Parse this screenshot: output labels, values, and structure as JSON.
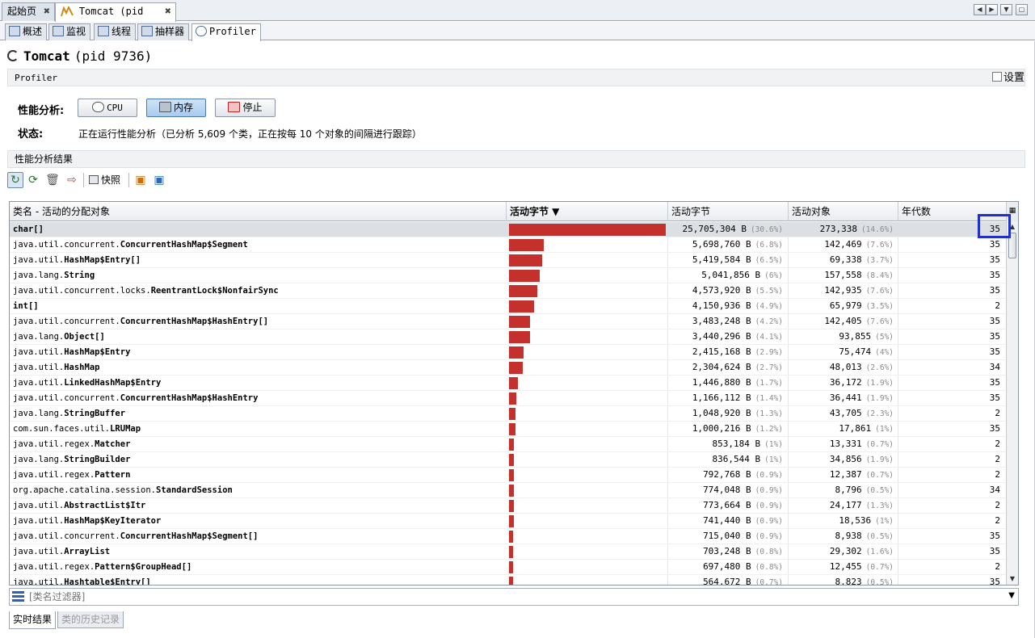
{
  "doc_tabs": [
    {
      "label": "起始页"
    },
    {
      "label": "Tomcat (pid 9736)"
    }
  ],
  "sub_tabs": [
    {
      "label": "概述"
    },
    {
      "label": "监视"
    },
    {
      "label": "线程"
    },
    {
      "label": "抽样器"
    },
    {
      "label": "Profiler"
    }
  ],
  "header": {
    "app_name": "Tomcat",
    "pid": "(pid 9736)"
  },
  "profiler_section": {
    "title": "Profiler",
    "settings_label": "设置"
  },
  "controls": {
    "analysis_label": "性能分析:",
    "cpu_label": "CPU",
    "memory_label": "内存",
    "stop_label": "停止",
    "status_label": "状态:",
    "status_text": "正在运行性能分析（已分析 5,609 个类，正在按每 10 个对象的间隔进行跟踪）"
  },
  "results_section": {
    "title": "性能分析结果",
    "snapshot_label": "快照"
  },
  "table": {
    "columns": [
      "类名 - 活动的分配对象",
      "活动字节 ▼",
      "活动字节",
      "活动对象",
      "年代数"
    ],
    "rows": [
      {
        "pkg": "",
        "cls": "char[]",
        "bytes": "25,705,304 B",
        "bytes_pct": "(30.6%)",
        "objs": "273,338",
        "objs_pct": "(14.6%)",
        "gen": "35",
        "bar": 1.0
      },
      {
        "pkg": "java.util.concurrent.",
        "cls": "ConcurrentHashMap$Segment",
        "bytes": "5,698,760 B",
        "bytes_pct": "(6.8%)",
        "objs": "142,469",
        "objs_pct": "(7.6%)",
        "gen": "35",
        "bar": 0.222
      },
      {
        "pkg": "java.util.",
        "cls": "HashMap$Entry[]",
        "bytes": "5,419,584 B",
        "bytes_pct": "(6.5%)",
        "objs": "69,338",
        "objs_pct": "(3.7%)",
        "gen": "35",
        "bar": 0.211
      },
      {
        "pkg": "java.lang.",
        "cls": "String",
        "bytes": "5,041,856 B",
        "bytes_pct": "(6%)",
        "objs": "157,558",
        "objs_pct": "(8.4%)",
        "gen": "35",
        "bar": 0.196
      },
      {
        "pkg": "java.util.concurrent.locks.",
        "cls": "ReentrantLock$NonfairSync",
        "bytes": "4,573,920 B",
        "bytes_pct": "(5.5%)",
        "objs": "142,935",
        "objs_pct": "(7.6%)",
        "gen": "35",
        "bar": 0.178
      },
      {
        "pkg": "",
        "cls": "int[]",
        "bytes": "4,150,936 B",
        "bytes_pct": "(4.9%)",
        "objs": "65,979",
        "objs_pct": "(3.5%)",
        "gen": "2",
        "bar": 0.161
      },
      {
        "pkg": "java.util.concurrent.",
        "cls": "ConcurrentHashMap$HashEntry[]",
        "bytes": "3,483,248 B",
        "bytes_pct": "(4.2%)",
        "objs": "142,405",
        "objs_pct": "(7.6%)",
        "gen": "35",
        "bar": 0.135
      },
      {
        "pkg": "java.lang.",
        "cls": "Object[]",
        "bytes": "3,440,296 B",
        "bytes_pct": "(4.1%)",
        "objs": "93,855",
        "objs_pct": "(5%)",
        "gen": "35",
        "bar": 0.134
      },
      {
        "pkg": "java.util.",
        "cls": "HashMap$Entry",
        "bytes": "2,415,168 B",
        "bytes_pct": "(2.9%)",
        "objs": "75,474",
        "objs_pct": "(4%)",
        "gen": "35",
        "bar": 0.094
      },
      {
        "pkg": "java.util.",
        "cls": "HashMap",
        "bytes": "2,304,624 B",
        "bytes_pct": "(2.7%)",
        "objs": "48,013",
        "objs_pct": "(2.6%)",
        "gen": "34",
        "bar": 0.09
      },
      {
        "pkg": "java.util.",
        "cls": "LinkedHashMap$Entry",
        "bytes": "1,446,880 B",
        "bytes_pct": "(1.7%)",
        "objs": "36,172",
        "objs_pct": "(1.9%)",
        "gen": "35",
        "bar": 0.056
      },
      {
        "pkg": "java.util.concurrent.",
        "cls": "ConcurrentHashMap$HashEntry",
        "bytes": "1,166,112 B",
        "bytes_pct": "(1.4%)",
        "objs": "36,441",
        "objs_pct": "(1.9%)",
        "gen": "35",
        "bar": 0.045
      },
      {
        "pkg": "java.lang.",
        "cls": "StringBuffer",
        "bytes": "1,048,920 B",
        "bytes_pct": "(1.3%)",
        "objs": "43,705",
        "objs_pct": "(2.3%)",
        "gen": "2",
        "bar": 0.041
      },
      {
        "pkg": "com.sun.faces.util.",
        "cls": "LRUMap",
        "bytes": "1,000,216 B",
        "bytes_pct": "(1.2%)",
        "objs": "17,861",
        "objs_pct": "(1%)",
        "gen": "35",
        "bar": 0.039
      },
      {
        "pkg": "java.util.regex.",
        "cls": "Matcher",
        "bytes": "853,184 B",
        "bytes_pct": "(1%)",
        "objs": "13,331",
        "objs_pct": "(0.7%)",
        "gen": "2",
        "bar": 0.033
      },
      {
        "pkg": "java.lang.",
        "cls": "StringBuilder",
        "bytes": "836,544 B",
        "bytes_pct": "(1%)",
        "objs": "34,856",
        "objs_pct": "(1.9%)",
        "gen": "2",
        "bar": 0.033
      },
      {
        "pkg": "java.util.regex.",
        "cls": "Pattern",
        "bytes": "792,768 B",
        "bytes_pct": "(0.9%)",
        "objs": "12,387",
        "objs_pct": "(0.7%)",
        "gen": "2",
        "bar": 0.031
      },
      {
        "pkg": "org.apache.catalina.session.",
        "cls": "StandardSession",
        "bytes": "774,048 B",
        "bytes_pct": "(0.9%)",
        "objs": "8,796",
        "objs_pct": "(0.5%)",
        "gen": "34",
        "bar": 0.03
      },
      {
        "pkg": "java.util.",
        "cls": "AbstractList$Itr",
        "bytes": "773,664 B",
        "bytes_pct": "(0.9%)",
        "objs": "24,177",
        "objs_pct": "(1.3%)",
        "gen": "2",
        "bar": 0.03
      },
      {
        "pkg": "java.util.",
        "cls": "HashMap$KeyIterator",
        "bytes": "741,440 B",
        "bytes_pct": "(0.9%)",
        "objs": "18,536",
        "objs_pct": "(1%)",
        "gen": "2",
        "bar": 0.029
      },
      {
        "pkg": "java.util.concurrent.",
        "cls": "ConcurrentHashMap$Segment[]",
        "bytes": "715,040 B",
        "bytes_pct": "(0.9%)",
        "objs": "8,938",
        "objs_pct": "(0.5%)",
        "gen": "35",
        "bar": 0.028
      },
      {
        "pkg": "java.util.",
        "cls": "ArrayList",
        "bytes": "703,248 B",
        "bytes_pct": "(0.8%)",
        "objs": "29,302",
        "objs_pct": "(1.6%)",
        "gen": "35",
        "bar": 0.027
      },
      {
        "pkg": "java.util.regex.",
        "cls": "Pattern$GroupHead[]",
        "bytes": "697,480 B",
        "bytes_pct": "(0.8%)",
        "objs": "12,455",
        "objs_pct": "(0.7%)",
        "gen": "2",
        "bar": 0.027
      },
      {
        "pkg": "java.util.",
        "cls": "Hashtable$Entry[]",
        "bytes": "564,672 B",
        "bytes_pct": "(0.7%)",
        "objs": "8,823",
        "objs_pct": "(0.5%)",
        "gen": "35",
        "bar": 0.022
      }
    ]
  },
  "filter": {
    "placeholder": "[类名过滤器]"
  },
  "bottom_tabs": [
    {
      "label": "实时结果"
    },
    {
      "label": "类的历史记录"
    }
  ],
  "colors": {
    "bar": "#c4302b",
    "highlight": "#2030d0",
    "selected_row": "#dcdfe3"
  }
}
